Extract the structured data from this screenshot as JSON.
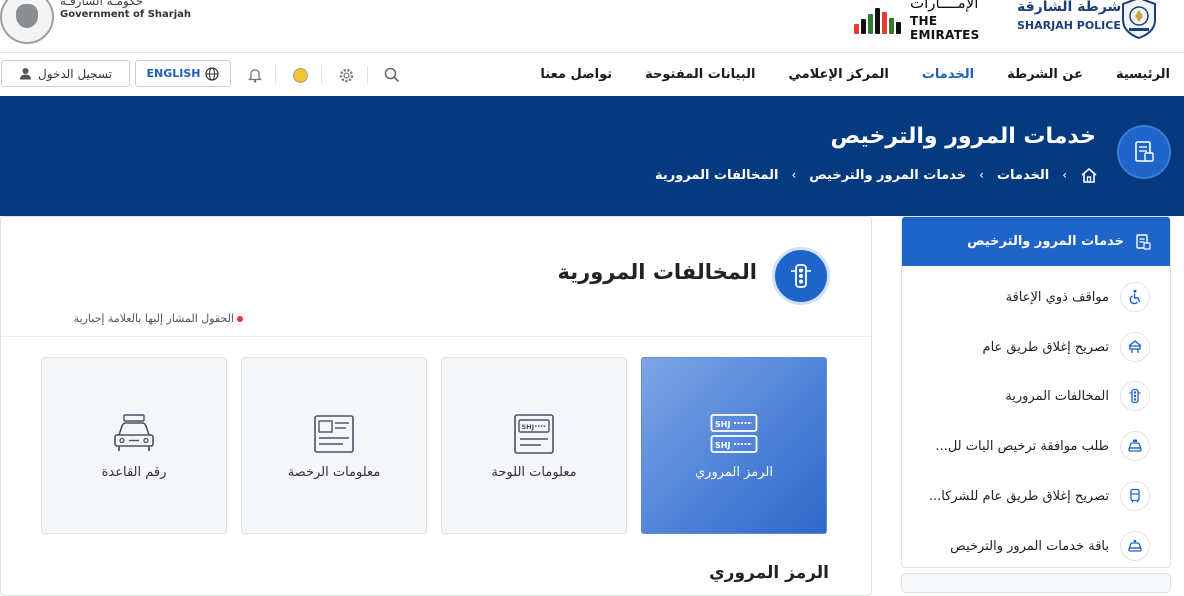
{
  "header": {
    "gov_logo": {
      "icon": "falcon-emblem-icon",
      "text_ar": "حكومـة الشارقـة",
      "text_en": "Government of Sharjah"
    },
    "emirates_logo": {
      "text_ar": "الإمــــارات",
      "text_en": "THE EMIRATES",
      "bar_colors": [
        "#e53935",
        "#111111",
        "#2e7d32",
        "#111111",
        "#e53935",
        "#2e7d32",
        "#111111"
      ]
    },
    "police_logo": {
      "icon": "police-emblem-icon",
      "text_ar": "شرطة الشارقة",
      "text_en": "SHARJAH POLICE"
    }
  },
  "navbar": {
    "login_label": "تسجيل الدخول",
    "language_label": "ENGLISH",
    "menu": [
      {
        "label": "الرئيسية",
        "active": false
      },
      {
        "label": "عن الشرطة",
        "active": false
      },
      {
        "label": "الخدمات",
        "active": true
      },
      {
        "label": "المركز الإعلامي",
        "active": false
      },
      {
        "label": "البيانات المفتوحة",
        "active": false
      },
      {
        "label": "تواصل معنا",
        "active": false
      }
    ],
    "icons": [
      "user-icon",
      "globe-icon",
      "bell-icon",
      "theme-toggle-icon",
      "settings-icon",
      "search-icon"
    ]
  },
  "hero": {
    "title": "خدمات المرور والترخيص",
    "icon": "document-icon",
    "breadcrumb": [
      "الخدمات",
      "خدمات المرور والترخيص",
      "المخالفات المرورية"
    ]
  },
  "sidebar": {
    "active_item": {
      "label": "خدمات المرور والترخيص",
      "icon": "document-icon"
    },
    "items": [
      {
        "label": "مواقف ذوي الإعاقة",
        "icon": "wheelchair-icon"
      },
      {
        "label": "تصريح إغلاق طريق عام",
        "icon": "road-closure-icon"
      },
      {
        "label": "المخالفات المرورية",
        "icon": "traffic-light-icon"
      },
      {
        "label": "طلب موافقة ترخيص آليات لل...",
        "icon": "car-license-icon"
      },
      {
        "label": "تصريح إغلاق طريق عام للشركا...",
        "icon": "bus-icon"
      },
      {
        "label": "باقة خدمات المرور والترخيص",
        "icon": "car-package-icon"
      }
    ]
  },
  "main": {
    "title": "المخالفات المرورية",
    "icon": "traffic-light-icon",
    "required_note": "الحقول المشار إليها بالعلامة إجبارية",
    "options": [
      {
        "label": "الرمز المروري",
        "icon": "plate-code-icon",
        "selected": true
      },
      {
        "label": "معلومات اللوحة",
        "icon": "plate-info-icon",
        "selected": false
      },
      {
        "label": "معلومات الرخصة",
        "icon": "license-card-icon",
        "selected": false
      },
      {
        "label": "رقم القاعدة",
        "icon": "car-front-icon",
        "selected": false
      }
    ],
    "section_title": "الرمز المروري"
  },
  "colors": {
    "primary": "#1f64c8",
    "hero_bg": "#063a80",
    "required": "#e53935"
  }
}
